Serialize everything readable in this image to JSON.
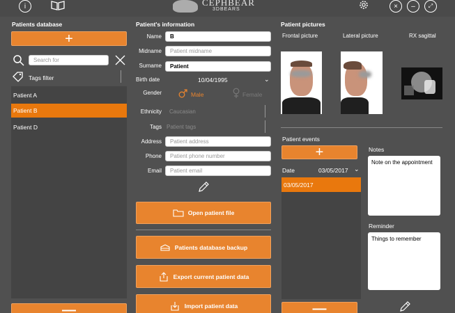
{
  "app": {
    "logo_title": "CEPHBEAR",
    "logo_sub": "3DBEARS"
  },
  "topbar": {
    "icons": [
      "info-icon",
      "book-icon",
      "gear-icon",
      "close-icon",
      "minimize-icon",
      "fullscreen-icon"
    ]
  },
  "database": {
    "title": "Patients database",
    "search_placeholder": "Search for",
    "tags_filter_label": "Tags filter",
    "patients": [
      {
        "name": "Patient A",
        "selected": false
      },
      {
        "name": "Patient B",
        "selected": true
      },
      {
        "name": "Patient D",
        "selected": false
      }
    ]
  },
  "info": {
    "title": "Patient's information",
    "name_label": "Name",
    "name_value": "B",
    "midname_label": "Midname",
    "midname_placeholder": "Patient midname",
    "surname_label": "Surname",
    "surname_value": "Patient",
    "birthdate_label": "Birth date",
    "birthdate_value": "10/04/1995",
    "gender_label": "Gender",
    "gender_male": "Male",
    "gender_female": "Female",
    "ethnicity_label": "Ethnicity",
    "ethnicity_value": "Caucasian",
    "tags_label": "Tags",
    "tags_placeholder": "Patient tags",
    "address_label": "Address",
    "address_placeholder": "Patient address",
    "phone_label": "Phone",
    "phone_placeholder": "Patient phone number",
    "email_label": "Email",
    "email_placeholder": "Patient email"
  },
  "actions": {
    "open_file": "Open patient file",
    "backup": "Patients database backup",
    "export": "Export current patient data",
    "import": "Import patient data"
  },
  "pictures": {
    "title": "Patient pictures",
    "frontal_label": "Frontal picture",
    "lateral_label": "Lateral picture",
    "rx_label": "RX sagittal"
  },
  "events": {
    "title": "Patient events",
    "date_label": "Date",
    "date_value": "03/05/2017",
    "items": [
      "03/05/2017"
    ],
    "notes_label": "Notes",
    "notes_value": "Note on the appointment",
    "reminder_label": "Reminder",
    "reminder_value": "Things to remember"
  },
  "colors": {
    "accent": "#e8842e",
    "selected": "#e9780d",
    "background": "#505050"
  }
}
